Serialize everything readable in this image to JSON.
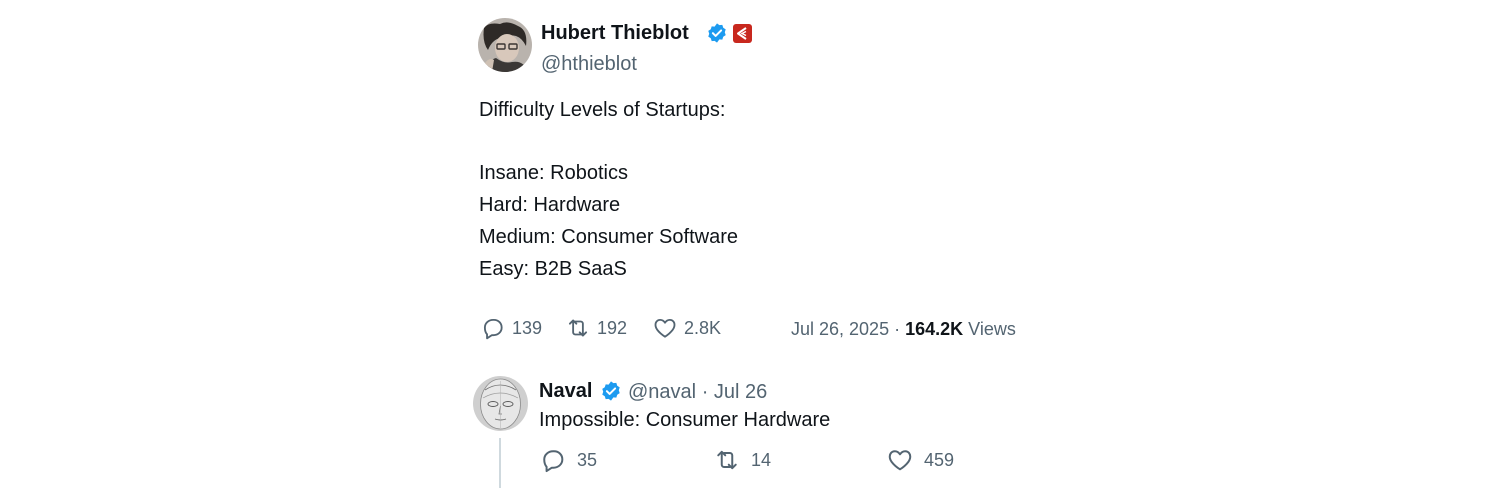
{
  "tweet": {
    "author": {
      "display_name": "Hubert Thieblot",
      "handle": "@hthieblot",
      "verified": true,
      "avatar_icon": "person-avatar-photo",
      "affiliation_icon": "affiliate-badge-icon",
      "affiliation_color": "#c8281e"
    },
    "lines": [
      "Difficulty Levels of Startups:",
      "",
      "Insane: Robotics",
      "Hard: Hardware",
      "Medium: Consumer Software",
      "Easy: B2B SaaS"
    ],
    "stats": {
      "replies": "139",
      "reposts": "192",
      "likes": "2.8K"
    },
    "date": "Jul 26, 2025",
    "separator": "·",
    "views_count": "164.2K",
    "views_label": "Views"
  },
  "reply": {
    "author": {
      "display_name": "Naval",
      "handle": "@naval",
      "verified": true,
      "avatar_icon": "sketch-face-avatar"
    },
    "separator": "·",
    "date": "Jul 26",
    "text": "Impossible: Consumer Hardware",
    "stats": {
      "replies": "35",
      "reposts": "14",
      "likes": "459"
    }
  },
  "colors": {
    "text_primary": "#0f1419",
    "text_secondary": "#536471",
    "verified_blue": "#1d9bf0",
    "thread_line": "#cfd9de"
  }
}
